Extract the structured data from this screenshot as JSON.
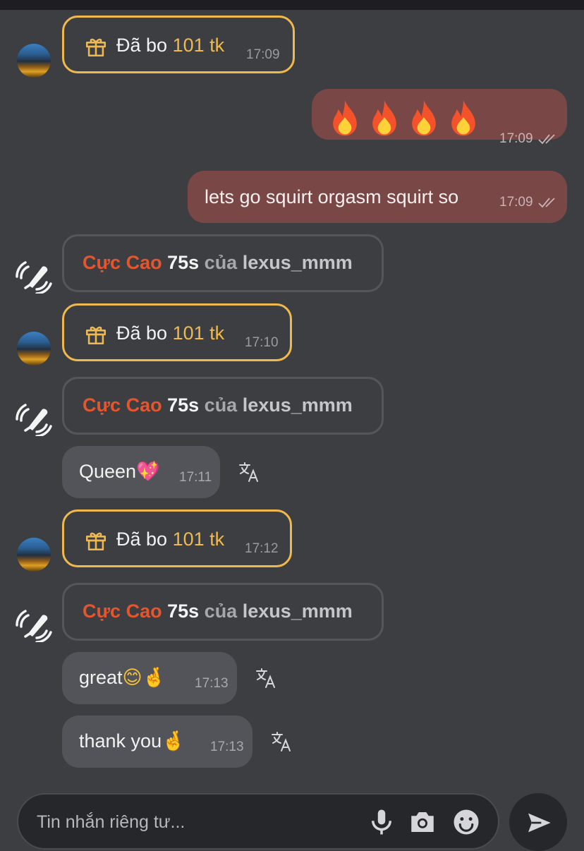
{
  "messages": {
    "tip1": {
      "prefix": "Đã bo ",
      "amount": "101 tk",
      "time": "17:09"
    },
    "out1": {
      "emoji": "🔥🔥🔥🔥",
      "time": "17:09"
    },
    "out2": {
      "text": "lets go squirt orgasm squirt so",
      "time": "17:09"
    },
    "vib1": {
      "level": "Cực Cao",
      "duration": "75s",
      "of": "của",
      "user": "lexus_mmm"
    },
    "tip2": {
      "prefix": "Đã bo ",
      "amount": "101 tk",
      "time": "17:10"
    },
    "vib2": {
      "level": "Cực Cao",
      "duration": "75s",
      "of": "của",
      "user": "lexus_mmm"
    },
    "in1": {
      "text": "Queen",
      "emoji": "💖",
      "time": "17:11"
    },
    "tip3": {
      "prefix": "Đã bo ",
      "amount": "101 tk",
      "time": "17:12"
    },
    "vib3": {
      "level": "Cực Cao",
      "duration": "75s",
      "of": "của",
      "user": "lexus_mmm"
    },
    "in2": {
      "text": "great",
      "emoji": "😊🤞",
      "time": "17:13"
    },
    "in3": {
      "text": "thank you",
      "emoji": "🤞",
      "time": "17:13"
    }
  },
  "composer": {
    "placeholder": "Tin nhắn riêng tư..."
  },
  "icons": {
    "gift": "gift-icon",
    "vibrator": "vibrator-icon",
    "translate": "translate-icon",
    "read_receipt": "double-check-icon",
    "mic": "microphone-icon",
    "camera": "camera-icon",
    "emoji": "emoji-icon",
    "send": "send-icon"
  },
  "colors": {
    "background": "#3d3e42",
    "tip_border": "#f0b94d",
    "vibe_level": "#e5552e",
    "outgoing_bubble": "#7a4747",
    "incoming_bubble": "#535459"
  }
}
